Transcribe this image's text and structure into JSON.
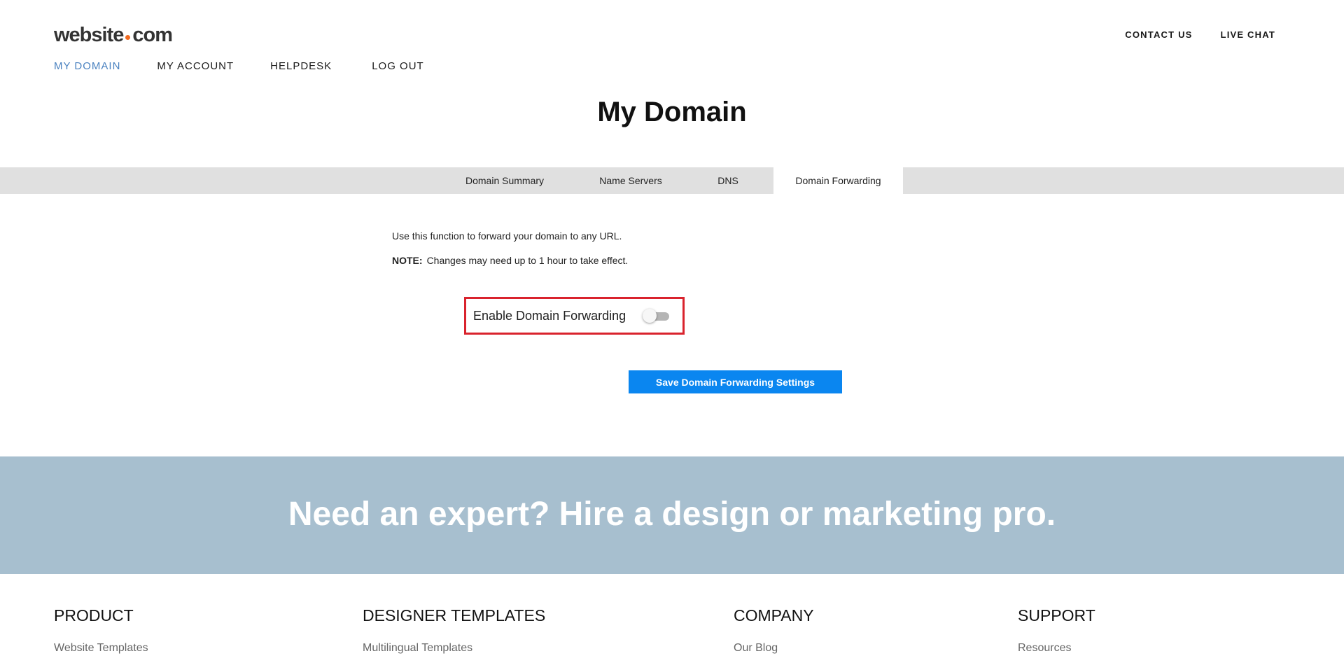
{
  "header": {
    "logo": {
      "left": "website",
      "right": "com"
    },
    "nav": [
      {
        "label": "MY DOMAIN",
        "active": true
      },
      {
        "label": "MY ACCOUNT",
        "active": false
      },
      {
        "label": "HELPDESK",
        "active": false
      },
      {
        "label": "LOG OUT",
        "active": false
      }
    ],
    "top_links": [
      {
        "label": "CONTACT US"
      },
      {
        "label": "LIVE CHAT"
      }
    ]
  },
  "page_title": "My Domain",
  "tabs": [
    {
      "label": "Domain Summary",
      "active": false
    },
    {
      "label": "Name Servers",
      "active": false
    },
    {
      "label": "DNS",
      "active": false
    },
    {
      "label": "Domain Forwarding",
      "active": true
    }
  ],
  "forwarding": {
    "description": "Use this function to forward your domain to any URL.",
    "note_label": "NOTE:",
    "note_text": "Changes may need up to 1 hour to take effect.",
    "toggle_label": "Enable Domain Forwarding",
    "toggle_on": false,
    "save_label": "Save Domain Forwarding Settings"
  },
  "promo": {
    "text": "Need an expert? Hire a design or marketing pro."
  },
  "footer": [
    {
      "heading": "PRODUCT",
      "first_link": "Website Templates"
    },
    {
      "heading": "DESIGNER TEMPLATES",
      "first_link": "Multilingual Templates"
    },
    {
      "heading": "COMPANY",
      "first_link": "Our Blog"
    },
    {
      "heading": "SUPPORT",
      "first_link": "Resources"
    }
  ],
  "colors": {
    "accent_blue": "#0a86f0",
    "nav_active": "#4a82c0",
    "logo_dot": "#f26b21",
    "highlight_border": "#d9232d",
    "promo_bg": "#a7bfcf",
    "tabbar_bg": "#e0e0e0"
  }
}
